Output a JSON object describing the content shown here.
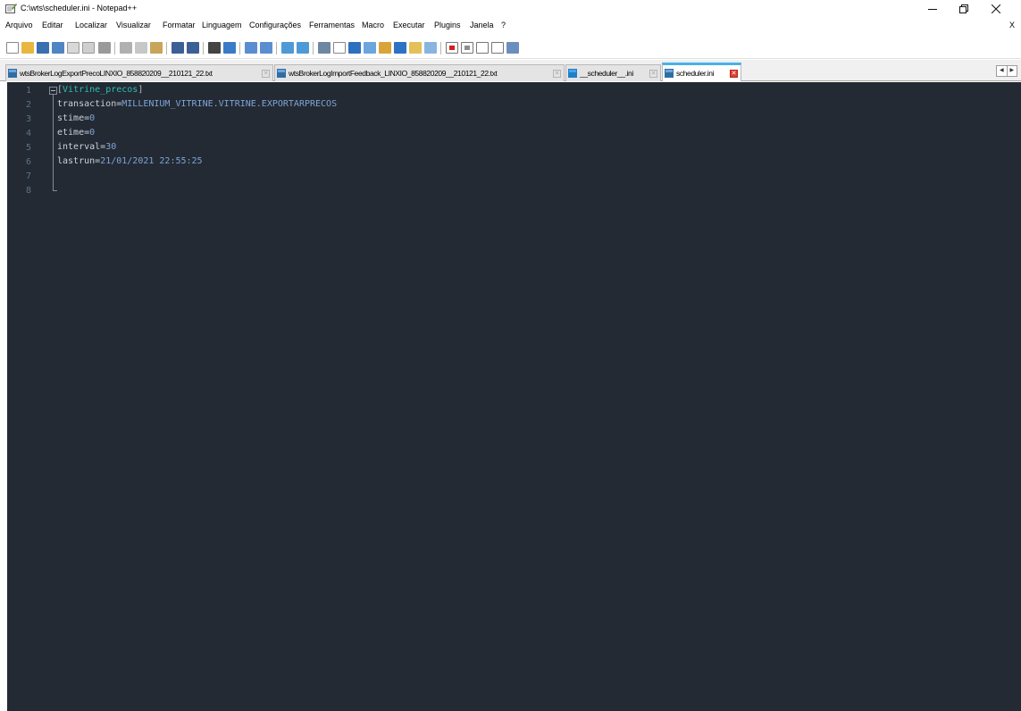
{
  "window": {
    "title": "C:\\wts\\scheduler.ini - Notepad++",
    "minimize_icon": "minimize-icon",
    "maximize_icon": "restore-icon",
    "close_icon": "close-icon"
  },
  "menu": {
    "items": [
      "Arquivo",
      "Editar",
      "Localizar",
      "Visualizar",
      "Formatar",
      "Linguagem",
      "Configurações",
      "Ferramentas",
      "Macro",
      "Executar",
      "Plugins",
      "Janela",
      "?"
    ],
    "close_label": "X"
  },
  "toolbar": {
    "icons": [
      "new-file-icon",
      "open-file-icon",
      "save-icon",
      "save-all-icon",
      "close-icon",
      "close-all-icon",
      "print-icon",
      "cut-icon",
      "copy-icon",
      "paste-icon",
      "undo-icon",
      "redo-icon",
      "find-icon",
      "replace-icon",
      "zoom-in-icon",
      "zoom-out-icon",
      "sync-vertical-icon",
      "sync-horizontal-icon",
      "word-wrap-icon",
      "show-all-chars-icon",
      "indent-guide-icon",
      "udl-icon",
      "doc-map-icon",
      "function-list-icon",
      "folder-workspace-icon",
      "monitoring-icon",
      "record-macro-icon",
      "stop-record-icon",
      "play-macro-icon",
      "run-macro-multiple-icon",
      "save-macro-icon"
    ]
  },
  "tabs": [
    {
      "label": "wtsBrokerLogExportPrecoLINXIO_858820209__210121_22.txt",
      "active": false
    },
    {
      "label": "wtsBrokerLogImportFeedback_LINXIO_858820209__210121_22.txt",
      "active": false
    },
    {
      "label": "__scheduler__.ini",
      "active": false
    },
    {
      "label": "scheduler.ini",
      "active": true
    }
  ],
  "editor": {
    "line_numbers": [
      "1",
      "2",
      "3",
      "4",
      "5",
      "6",
      "7",
      "8"
    ],
    "section": {
      "open": "[",
      "name": "Vitrine_precos",
      "close": "]"
    },
    "entries": [
      {
        "key": "transaction",
        "eq": "=",
        "value": "MILLENIUM_VITRINE.VITRINE.EXPORTARPRECOS"
      },
      {
        "key": "stime",
        "eq": "=",
        "value": "0"
      },
      {
        "key": "etime",
        "eq": "=",
        "value": "0"
      },
      {
        "key": "interval",
        "eq": "=",
        "value": "30"
      },
      {
        "key": "lastrun",
        "eq": "=",
        "value": "21/01/2021 22:55:25"
      }
    ]
  },
  "colors": {
    "editor_bg": "#232a34",
    "section_name": "#2bc0ac",
    "value": "#7fa4d4",
    "active_tab_accent": "#48b2e8"
  }
}
